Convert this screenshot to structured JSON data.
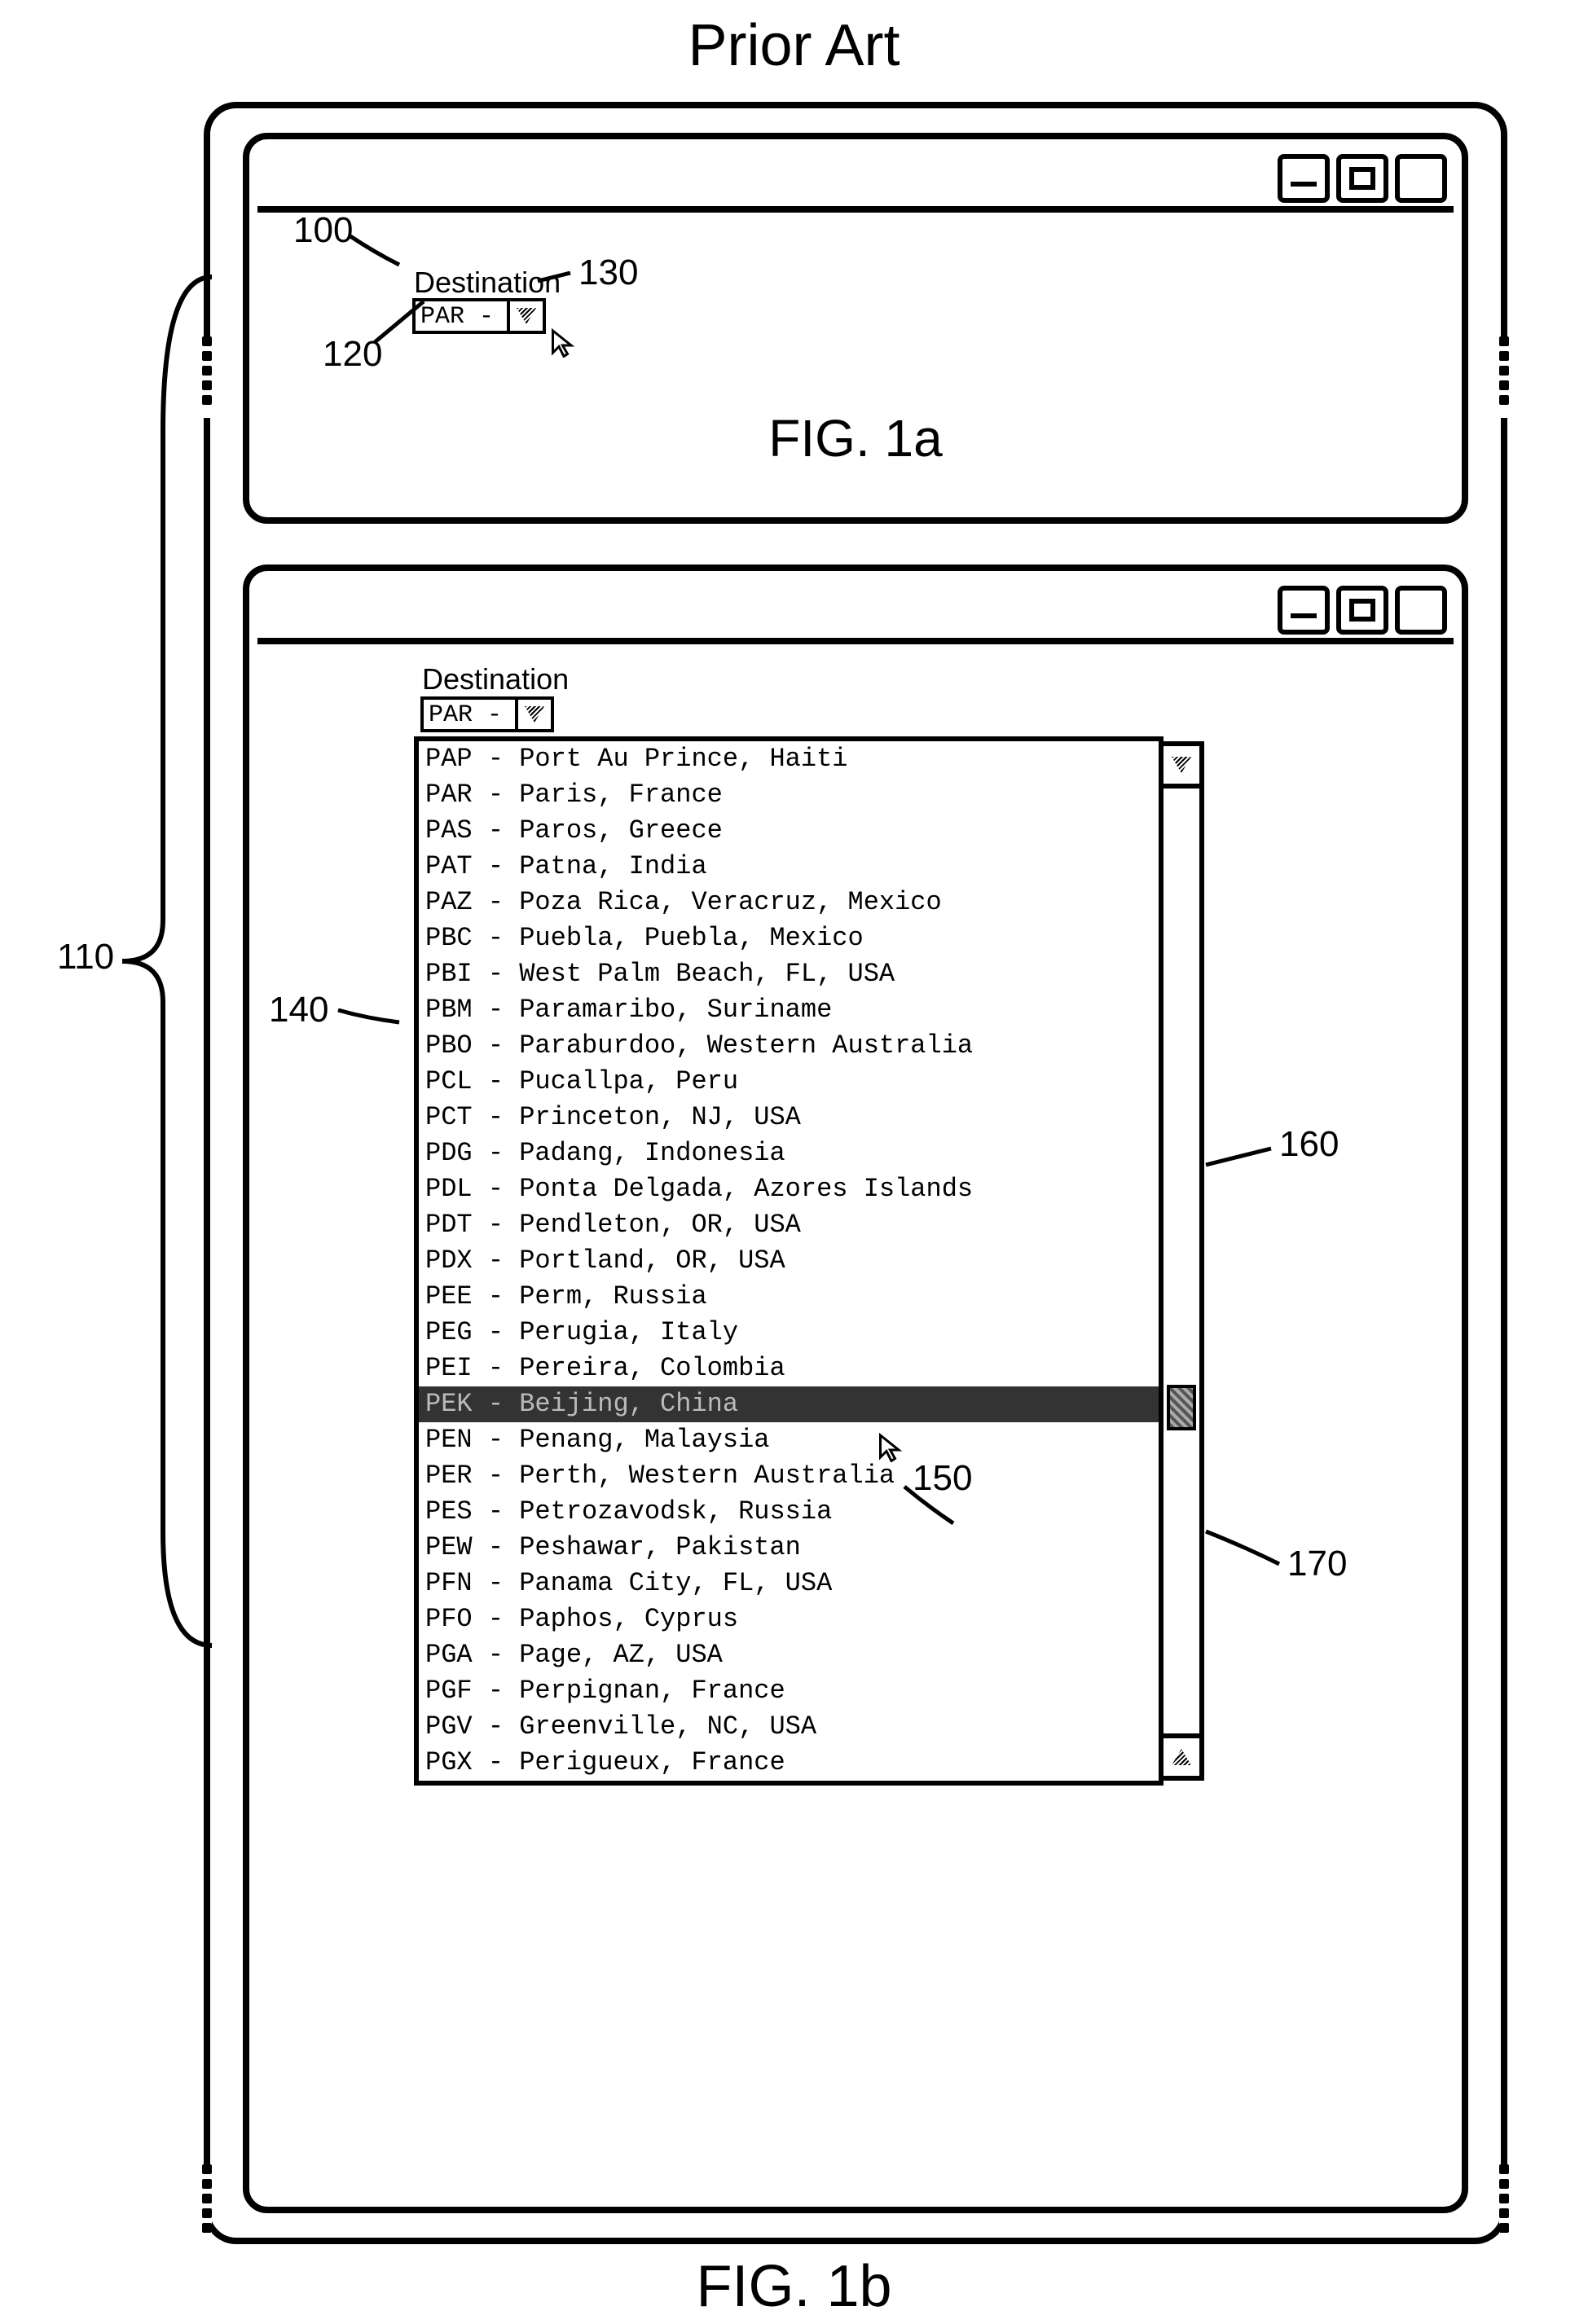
{
  "title": "Prior Art",
  "fig_a_label": "FIG. 1a",
  "fig_b_label": "FIG. 1b",
  "callouts": {
    "c100": "100",
    "c110": "110",
    "c120": "120",
    "c130": "130",
    "c140": "140",
    "c150": "150",
    "c160": "160",
    "c170": "170"
  },
  "win_a": {
    "dest_label": "Destination",
    "combo_value": "PAR -"
  },
  "win_b": {
    "dest_label": "Destination",
    "combo_value": "PAR -",
    "selected_index": 18,
    "items": [
      "PAP - Port Au Prince, Haiti",
      "PAR - Paris, France",
      "PAS - Paros, Greece",
      "PAT - Patna, India",
      "PAZ - Poza Rica, Veracruz, Mexico",
      "PBC - Puebla, Puebla, Mexico",
      "PBI - West Palm Beach, FL, USA",
      "PBM - Paramaribo, Suriname",
      "PBO - Paraburdoo, Western Australia",
      "PCL - Pucallpa, Peru",
      "PCT - Princeton, NJ, USA",
      "PDG - Padang, Indonesia",
      "PDL - Ponta Delgada, Azores Islands",
      "PDT - Pendleton, OR, USA",
      "PDX - Portland, OR, USA",
      "PEE - Perm, Russia",
      "PEG - Perugia, Italy",
      "PEI - Pereira, Colombia",
      "PEK - Beijing, China",
      "PEN - Penang, Malaysia",
      "PER - Perth, Western Australia",
      "PES - Petrozavodsk, Russia",
      "PEW - Peshawar, Pakistan",
      "PFN - Panama City, FL, USA",
      "PFO - Paphos, Cyprus",
      "PGA - Page, AZ, USA",
      "PGF - Perpignan, France",
      "PGV - Greenville, NC, USA",
      "PGX - Perigueux, France"
    ]
  }
}
